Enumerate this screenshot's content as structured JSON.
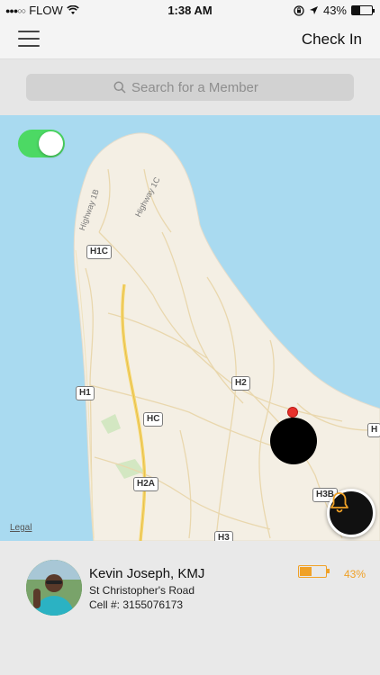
{
  "status_bar": {
    "carrier": "FLOW",
    "time": "1:38 AM",
    "battery_percent": "43%",
    "battery_level": 0.43,
    "icons": [
      "signal-dots-icon",
      "wifi-icon",
      "rotation-lock-icon",
      "location-arrow-icon",
      "battery-icon"
    ]
  },
  "nav": {
    "menu_icon": "hamburger-menu-icon",
    "checkin_label": "Check In"
  },
  "search": {
    "placeholder": "Search for a Member",
    "value": "",
    "icon": "search-icon"
  },
  "map": {
    "toggle_on": true,
    "road_labels": [
      "H1C",
      "H2",
      "H1",
      "HC",
      "H2A",
      "H3B",
      "H3",
      "H"
    ],
    "highway_names": [
      "Highway 1B",
      "Highway 1C"
    ],
    "legal_label": "Legal",
    "bell_icon": "bell-icon",
    "colors": {
      "water": "#a9daf0",
      "land": "#f4efe4",
      "toggle": "#4cd964"
    }
  },
  "member": {
    "name": "Kevin Joseph, KMJ",
    "address": "St Christopher's Road",
    "cell": "Cell #: 3155076173",
    "battery_percent": "43%",
    "battery_level": 0.43,
    "accent_color": "#f0a127"
  }
}
